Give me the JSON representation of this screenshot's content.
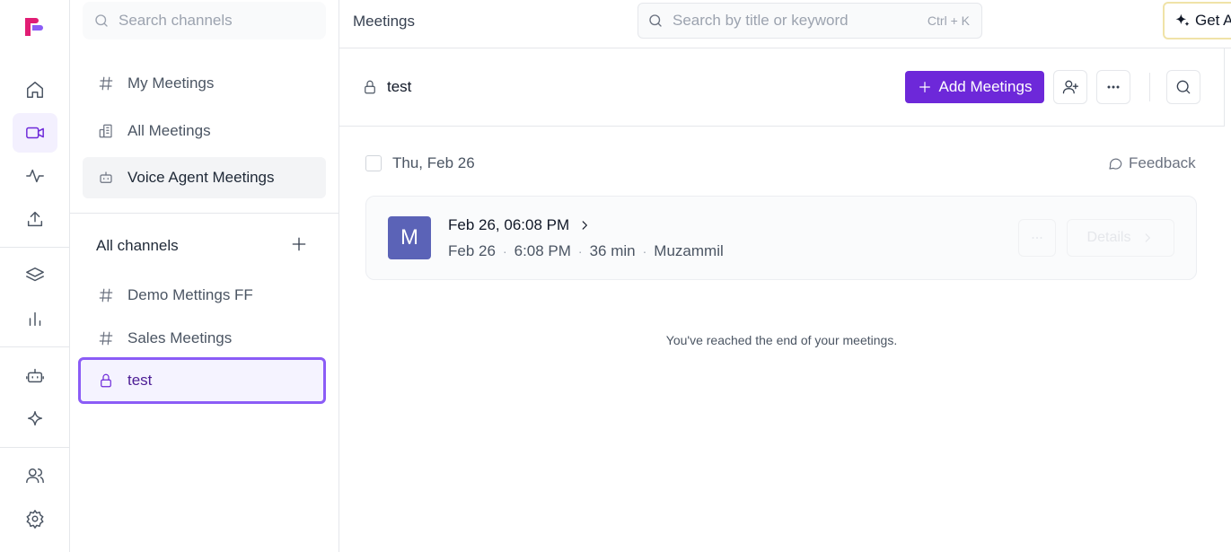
{
  "rail": {
    "items": [
      {
        "name": "home-icon",
        "active": false
      },
      {
        "name": "video-icon",
        "active": true
      },
      {
        "name": "activity-icon",
        "active": false
      },
      {
        "name": "upload-icon",
        "active": false
      },
      {
        "name": "layers-icon",
        "active": false
      },
      {
        "name": "bar-chart-icon",
        "active": false
      },
      {
        "name": "bot-icon",
        "active": false
      },
      {
        "name": "sparkle-icon",
        "active": false
      },
      {
        "name": "users-icon",
        "active": false
      },
      {
        "name": "gear-icon",
        "active": false
      }
    ],
    "accent": "#6d28d9"
  },
  "sidebar": {
    "search_placeholder": "Search channels",
    "items": [
      {
        "label": "My Meetings",
        "icon": "hash-icon"
      },
      {
        "label": "All Meetings",
        "icon": "building-icon"
      },
      {
        "label": "Voice Agent Meetings",
        "icon": "bot-icon"
      }
    ],
    "all_channels_label": "All channels",
    "channels": [
      {
        "label": "Demo Mettings FF",
        "icon": "hash-icon"
      },
      {
        "label": "Sales Meetings",
        "icon": "hash-icon"
      },
      {
        "label": "test",
        "icon": "lock-icon",
        "selected": true
      }
    ]
  },
  "topbar": {
    "title": "Meetings",
    "search_placeholder": "Search by title or keyword",
    "shortcut": "Ctrl + K",
    "get_ai_label": "Get A"
  },
  "channel_header": {
    "name": "test",
    "add_button_label": "Add Meetings"
  },
  "content": {
    "day_label": "Thu, Feb 26",
    "feedback_label": "Feedback",
    "meetings": [
      {
        "avatar_letter": "M",
        "avatar_color": "#5b63b7",
        "title": "Feb 26, 06:08 PM",
        "date": "Feb 26",
        "time": "6:08 PM",
        "duration": "36 min",
        "owner": "Muzammil",
        "details_label": "Details"
      }
    ],
    "end_note": "You've reached the end of your meetings."
  }
}
